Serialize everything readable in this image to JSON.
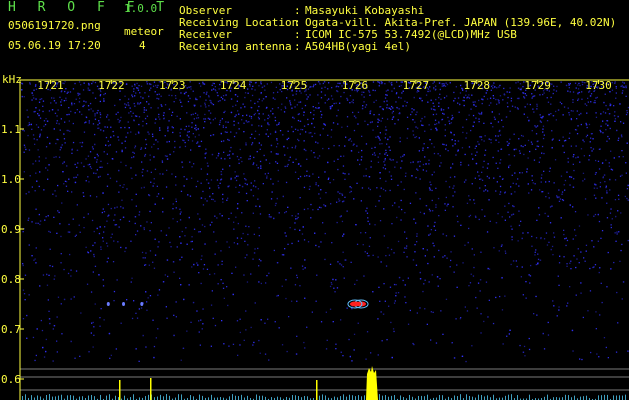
{
  "app": {
    "name": "H R O F F T",
    "version": "1.0.0",
    "file": "0506191720.png",
    "datetime": "05.06.19 17:20",
    "meteor_label": "meteor",
    "meteor_count": "4"
  },
  "info": {
    "rows": [
      {
        "label": "Observer",
        "sep": ":",
        "value": "Masayuki Kobayashi"
      },
      {
        "label": "Receiving Location",
        "sep": ":",
        "value": "Ogata-vill. Akita-Pref. JAPAN (139.96E, 40.02N)"
      },
      {
        "label": "Receiver",
        "sep": ":",
        "value": "ICOM IC-575 53.7492(@LCD)MHz USB"
      },
      {
        "label": "Receiving antenna",
        "sep": ":",
        "value": "A504HB(yagi 4el)"
      }
    ]
  },
  "chart_data": {
    "type": "heatmap",
    "ylabel": "kHz",
    "x_ticks": [
      "1721",
      "1722",
      "1723",
      "1724",
      "1725",
      "1726",
      "1727",
      "1728",
      "1729",
      "1730"
    ],
    "y_ticks": [
      "1.1",
      "1.0",
      "0.9",
      "0.8",
      "0.7",
      "0.6"
    ],
    "y_values": [
      1.1,
      1.0,
      0.9,
      0.8,
      0.7,
      0.6
    ],
    "x_range": [
      1720.5,
      1730.5
    ],
    "echoes": [
      {
        "x": 1721.95,
        "y": 0.75
      },
      {
        "x": 1722.2,
        "y": 0.75
      },
      {
        "x": 1722.5,
        "y": 0.75
      },
      {
        "x": 1726.1,
        "y": 0.75
      },
      {
        "x": 1726.0,
        "y": 0.75
      }
    ],
    "colors": {
      "background": "#000000",
      "noise": "#2020c8",
      "echo": "#ff2020",
      "axis": "#ffff40",
      "spectrum": "#ffff00"
    }
  }
}
